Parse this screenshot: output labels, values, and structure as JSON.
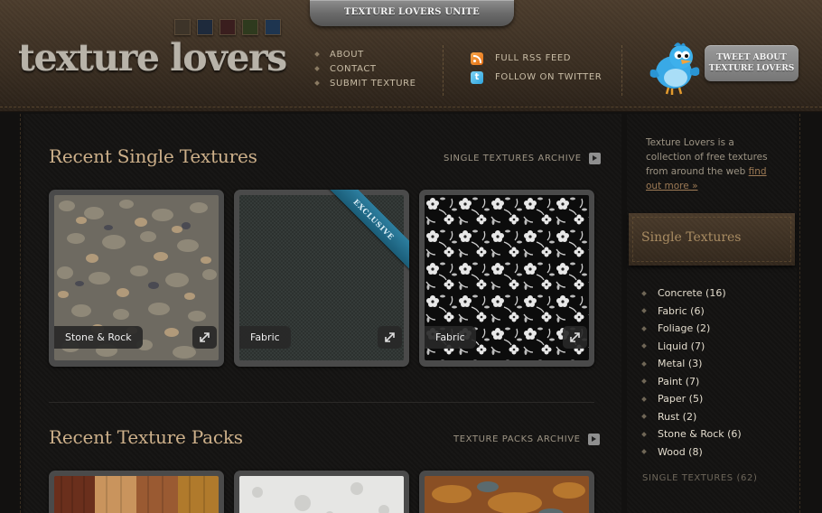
{
  "header": {
    "ribbon_text": "TEXTURE LOVERS UNITE",
    "logo_text": "texture lovers",
    "swatches": [
      {
        "name": "brown",
        "color": "#3d3429"
      },
      {
        "name": "navy",
        "color": "#1e2a3c"
      },
      {
        "name": "maroon",
        "color": "#3a1e1e"
      },
      {
        "name": "olive",
        "color": "#2e3a1e"
      },
      {
        "name": "blue",
        "color": "#1e3550"
      }
    ],
    "nav": {
      "items": [
        {
          "label": "ABOUT"
        },
        {
          "label": "CONTACT"
        },
        {
          "label": "SUBMIT TEXTURE"
        }
      ]
    },
    "social": {
      "rss_label": "FULL RSS FEED",
      "twitter_label": "FOLLOW ON TWITTER",
      "rss_icon": "rss-icon",
      "twitter_icon": "twitter-icon"
    },
    "tweet_button": {
      "line1": "TWEET ABOUT",
      "line2": "TEXTURE LOVERS"
    }
  },
  "main": {
    "single_section": {
      "title": "Recent Single Textures",
      "archive_label": "SINGLE TEXTURES ARCHIVE",
      "cards": [
        {
          "tag": "Stone & Rock",
          "exclusive": false
        },
        {
          "tag": "Fabric",
          "exclusive": true,
          "ribbon": "EXCLUSIVE"
        },
        {
          "tag": "Fabric",
          "exclusive": false
        }
      ]
    },
    "packs_section": {
      "title": "Recent Texture Packs",
      "archive_label": "TEXTURE PACKS ARCHIVE"
    }
  },
  "sidebar": {
    "intro_text": "Texture Lovers is a collection of free textures from around the web",
    "intro_link": "find out more »",
    "banner_title": "Single Textures",
    "categories": [
      {
        "label": "Concrete (16)"
      },
      {
        "label": "Fabric (6)"
      },
      {
        "label": "Foliage (2)"
      },
      {
        "label": "Liquid (7)"
      },
      {
        "label": "Metal (3)"
      },
      {
        "label": "Paint (7)"
      },
      {
        "label": "Paper (5)"
      },
      {
        "label": "Rust (2)"
      },
      {
        "label": "Stone & Rock (6)"
      },
      {
        "label": "Wood (8)"
      }
    ],
    "total_label": "SINGLE TEXTURES (62)"
  },
  "colors": {
    "accent_gold": "#cdb08a",
    "header_brown": "#3a2e22",
    "body_dark": "#121110",
    "exclusive_blue": "#2d7fa0"
  }
}
